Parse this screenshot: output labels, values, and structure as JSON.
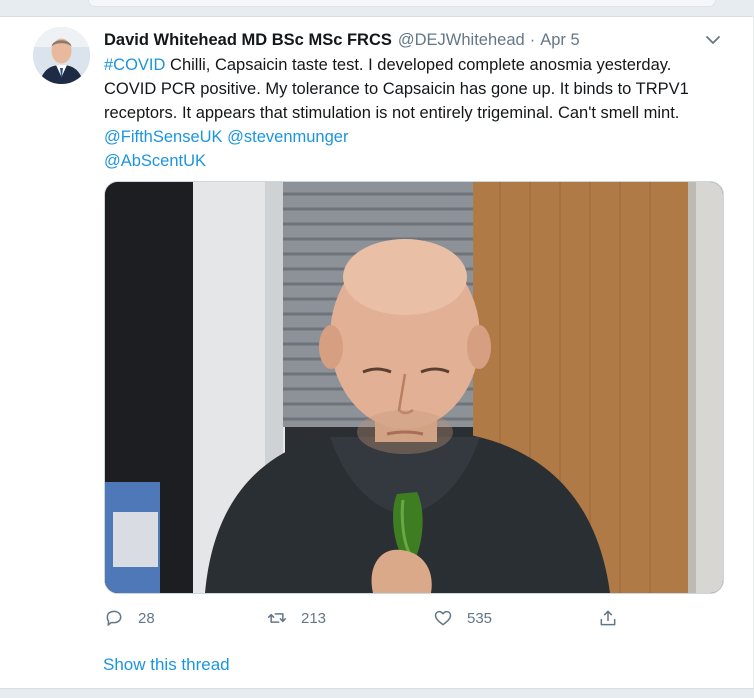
{
  "tweet": {
    "author_name": "David Whitehead MD BSc MSc FRCS",
    "handle": "@DEJWhitehead",
    "separator": "·",
    "date": "Apr 5",
    "text_parts": {
      "hashtag": "#COVID",
      "line1_rest": " Chilli, Capsaicin taste test. I developed complete anosmia yesterday. COVID PCR positive. My tolerance to Capsaicin has gone up. It binds to TRPV1 receptors. It appears that stimulation is not entirely trigeminal. Can't smell mint. ",
      "mention1": "@FifthSenseUK",
      "space": " ",
      "mention2": "@stevenmunger",
      "mention3": "@AbScentUK"
    },
    "actions": {
      "reply_count": "28",
      "retweet_count": "213",
      "like_count": "535",
      "reply_icon": "reply-icon",
      "retweet_icon": "retweet-icon",
      "like_icon": "heart-icon",
      "share_icon": "share-icon"
    },
    "show_thread": "Show this thread"
  },
  "colors": {
    "link": "#1b95e0",
    "muted": "#657786",
    "text": "#14171a"
  }
}
